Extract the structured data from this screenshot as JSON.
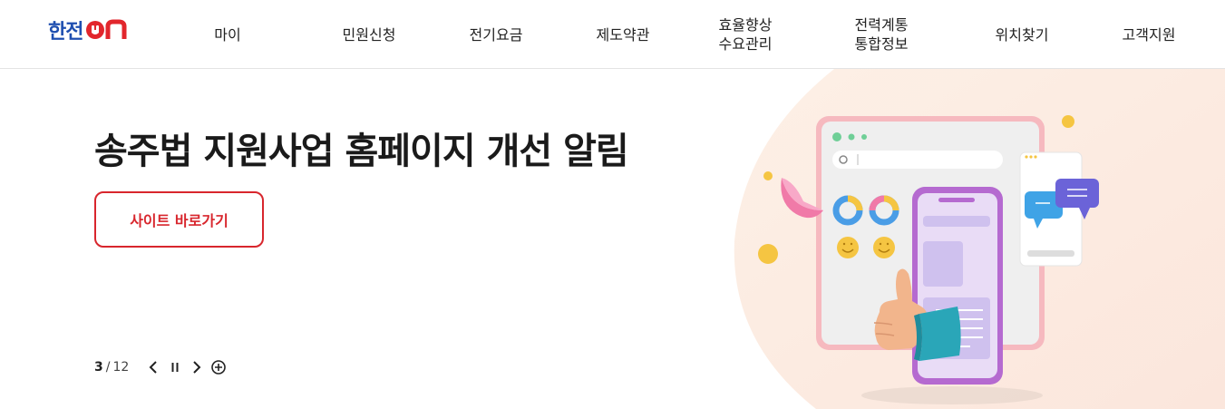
{
  "header": {
    "logo": {
      "text": "한전",
      "on_text": "ON",
      "brand_blue": "#1f4fb0",
      "brand_red": "#e2262c"
    },
    "nav": [
      {
        "label": "마이"
      },
      {
        "label": "민원신청"
      },
      {
        "label": "전기요금"
      },
      {
        "label": "제도약관"
      },
      {
        "label": "효율향상\n수요관리"
      },
      {
        "label": "전력계통\n통합정보"
      },
      {
        "label": "위치찾기"
      },
      {
        "label": "고객지원"
      }
    ]
  },
  "hero": {
    "title": "송주법 지원사업 홈페이지 개선 알림",
    "button_label": "사이트 바로가기",
    "accent_color": "#d8262d",
    "illustration_icon": "thumbs-up-phone-illustration"
  },
  "pager": {
    "current": "3",
    "separator": "/",
    "total": "12",
    "controls": {
      "prev_icon": "chevron-left-icon",
      "pause_icon": "pause-icon",
      "next_icon": "chevron-right-icon",
      "more_icon": "plus-circle-icon"
    }
  }
}
